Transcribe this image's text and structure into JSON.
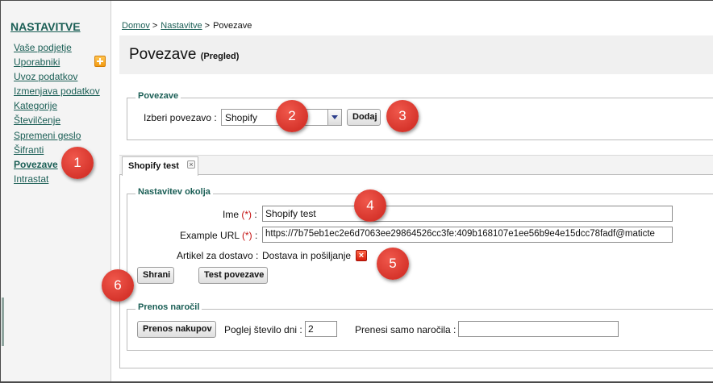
{
  "sidebar": {
    "title": "NASTAVITVE",
    "items": [
      {
        "label": "Vaše podjetje"
      },
      {
        "label": "Uporabniki"
      },
      {
        "label": "Uvoz podatkov"
      },
      {
        "label": "Izmenjava podatkov"
      },
      {
        "label": "Kategorije"
      },
      {
        "label": "Številčenje"
      },
      {
        "label": "Spremeni geslo"
      },
      {
        "label": "Šifranti"
      },
      {
        "label": "Povezave",
        "active": true
      },
      {
        "label": "Intrastat"
      }
    ]
  },
  "breadcrumb": {
    "home": "Domov",
    "settings": "Nastavitve",
    "current": "Povezave",
    "separator": ">"
  },
  "page": {
    "title": "Povezave",
    "subtitle": "(Pregled)"
  },
  "connections": {
    "legend": "Povezave",
    "select_label": "Izberi povezavo :",
    "select_value": "Shopify",
    "add_button": "Dodaj"
  },
  "tab": {
    "label": "Shopify test",
    "close": "×"
  },
  "environment": {
    "legend": "Nastavitev okolja",
    "name_label": "Ime",
    "url_label": "Example URL",
    "required_mark": "(*)",
    "colon": ":",
    "name_value": "Shopify test",
    "url_value": "https://7b75eb1ec2e6d7063ee29864526cc3fe:409b168107e1ee56b9e4e15dcc78fadf@maticte",
    "delivery_label": "Artikel za dostavo :",
    "delivery_value": "Dostava in pošiljanje",
    "save_button": "Shrani",
    "test_button": "Test povezave"
  },
  "orders": {
    "legend": "Prenos naročil",
    "transfer_button": "Prenos nakupov",
    "days_label": "Poglej število dni :",
    "days_value": "2",
    "only_orders_label": "Prenesi samo naročila :",
    "only_orders_value": ""
  },
  "callouts": [
    "1",
    "2",
    "3",
    "4",
    "5",
    "6"
  ],
  "colors": {
    "link": "#1a5e55",
    "callout": "#d6342b",
    "required": "#c41010"
  }
}
